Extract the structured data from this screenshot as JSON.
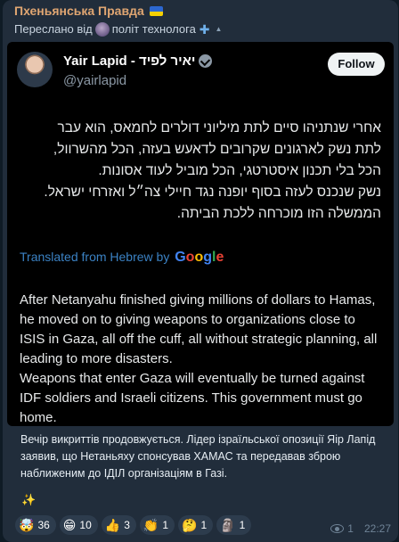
{
  "channel": {
    "name": "Пхеньянська Правда"
  },
  "forward": {
    "prefix": "Переслано від",
    "source": "політ технолога"
  },
  "tweet": {
    "author": "Yair Lapid - יאיר לפיד",
    "handle": "@yairlapid",
    "follow_label": "Follow",
    "hebrew_lines": [
      "אחרי שנתניהו סיים לתת מיליוני דולרים לחמאס, הוא עבר",
      "לתת נשק לארגונים שקרובים לדאעש בעזה, הכל מהשרוול,",
      "הכל בלי תכנון איסטרטגי, הכל מוביל לעוד אסונות.",
      "נשק שנכנס לעזה בסוף יופנה נגד חיילי צה״ל ואזרחי ישראל.",
      "הממשלה הזו מוכרחה ללכת הביתה."
    ],
    "translated_label": "Translated from Hebrew by",
    "translator": "Google",
    "english_paragraphs": [
      "After Netanyahu finished giving millions of dollars to Hamas, he moved on to giving weapons to organizations close to ISIS in Gaza, all off the cuff, all without strategic planning, all leading to more disasters.",
      "Weapons that enter Gaza will eventually be turned against IDF soldiers and Israeli citizens. This government must go home."
    ]
  },
  "caption": "Вечір викриттів продовжується. Лідер ізраїльської опозиції Яір Лапід заявив, що Нетаньяху спонсував ХАМАС та передавав зброю наближеним до ІДІЛ організаціям в Газі.",
  "reactions": [
    {
      "emoji": "🤯",
      "count": "36"
    },
    {
      "emoji": "😁",
      "count": "10"
    },
    {
      "emoji": "👍",
      "count": "3"
    },
    {
      "emoji": "👏",
      "count": "1"
    },
    {
      "emoji": "🤔",
      "count": "1"
    },
    {
      "emoji": "🗿",
      "count": "1"
    }
  ],
  "meta": {
    "views": "1",
    "time": "22:27"
  },
  "colors": {
    "bubble": "#212d3b",
    "channel_name": "#e0a672",
    "link": "#3b82c4",
    "tweet_bg": "#000000"
  }
}
